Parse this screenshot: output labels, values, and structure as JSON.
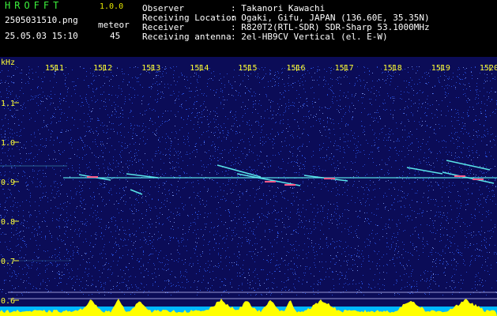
{
  "header": {
    "app_title": "HROFFT",
    "version": "1.0.0",
    "filename": "2505031510.png",
    "mode": "meteor",
    "timestamp": "25.05.03 15:10",
    "count": "45",
    "info_labels": [
      "Observer",
      "Receiving Location",
      "Receiver",
      "Receiving antenna"
    ],
    "info_values": [
      ": Takanori Kawachi",
      ": Ogaki, Gifu, JAPAN (136.60E, 35.35N)",
      ": R820T2(RTL-SDR) SDR-Sharp 53.1000MHz",
      ": 2el-HB9CV Vertical (el. E-W)"
    ]
  },
  "plot": {
    "y_unit": "kHz",
    "y_ticks": [
      "1.1",
      "1.0",
      "0.9",
      "0.8",
      "0.7",
      "0.6"
    ],
    "x_ticks": [
      "1511",
      "1512",
      "1513",
      "1514",
      "1515",
      "1516",
      "1517",
      "1518",
      "1519",
      "1520"
    ],
    "colors": {
      "background": "#0b0c57",
      "noise": "#2a56e8",
      "signal": "#5ef0f0",
      "meteor_core": "#ff5a8a",
      "spectrum": "#ffff00",
      "tick_text": "#ffff33"
    }
  }
}
